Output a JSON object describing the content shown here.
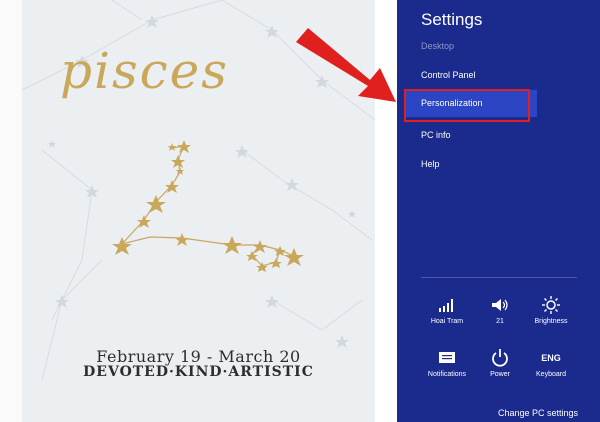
{
  "wallpaper": {
    "sign": "pisces",
    "dates": "February 19 - March 20",
    "traits": "DEVOTED·KIND·ARTISTIC"
  },
  "charm": {
    "title": "Settings",
    "items": [
      {
        "label": "Desktop",
        "state": "disabled"
      },
      {
        "label": "Control Panel",
        "state": "normal"
      },
      {
        "label": "Personalization",
        "state": "selected"
      },
      {
        "label": "PC info",
        "state": "normal"
      },
      {
        "label": "Help",
        "state": "normal"
      }
    ],
    "tiles": [
      {
        "label": "Hoai Tram",
        "icon": "wifi-signal-icon"
      },
      {
        "label": "21",
        "icon": "volume-icon"
      },
      {
        "label": "Brightness",
        "icon": "brightness-icon"
      },
      {
        "label": "Notifications",
        "icon": "notifications-icon"
      },
      {
        "label": "Power",
        "icon": "power-icon"
      },
      {
        "label": "Keyboard",
        "icon": "keyboard-icon",
        "glyph": "ENG"
      }
    ],
    "change_pc_settings": "Change PC settings"
  },
  "colors": {
    "charm_bg": "#1a2a8d",
    "selected_bg": "#2b45c4",
    "annotation_red": "#e01f1f",
    "gold": "#c9a85b"
  }
}
